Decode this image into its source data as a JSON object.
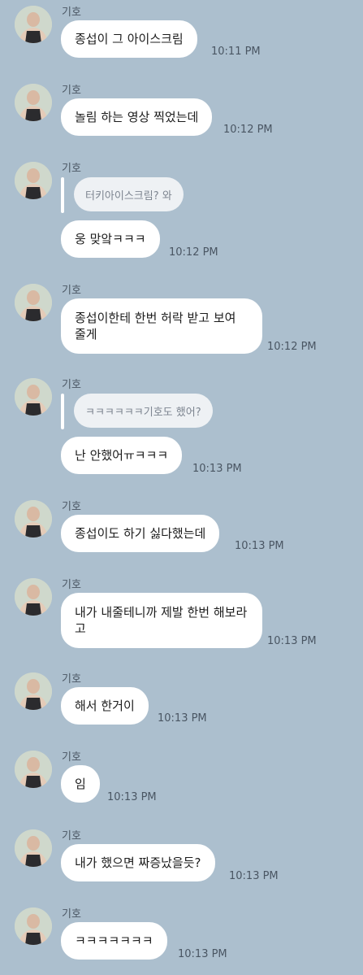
{
  "colors": {
    "background": "#acbfce",
    "bubble": "#ffffff",
    "quote_bubble": "#eef1f4"
  },
  "messages": [
    {
      "sender": "기호",
      "text": "종섭이 그 아이스크림",
      "time": "10:11 PM"
    },
    {
      "sender": "기호",
      "text": "놀림 하는 영상 찍었는데",
      "time": "10:12 PM"
    },
    {
      "sender": "기호",
      "quote": "터키아이스크림? 와",
      "text": "웅 맞앜ㅋㅋㅋ",
      "time": "10:12 PM"
    },
    {
      "sender": "기호",
      "text": "종섭이한테 한번 허락 받고 보여 줄게",
      "time": "10:12 PM"
    },
    {
      "sender": "기호",
      "quote": "ㅋㅋㅋㅋㅋㅋ기호도 했어?",
      "text": "난 안했어ㅠㅋㅋㅋ",
      "time": "10:13 PM"
    },
    {
      "sender": "기호",
      "text": "종섭이도 하기 싫다했는데",
      "time": "10:13 PM"
    },
    {
      "sender": "기호",
      "text": "내가 내줄테니까 제발 한번 해보라고",
      "time": "10:13 PM"
    },
    {
      "sender": "기호",
      "text": "해서 한거이",
      "time": "10:13 PM"
    },
    {
      "sender": "기호",
      "text": "임",
      "time": "10:13 PM"
    },
    {
      "sender": "기호",
      "text": "내가 했으면 짜증났을듯?",
      "time": "10:13 PM"
    },
    {
      "sender": "기호",
      "text": "ㅋㅋㅋㅋㅋㅋㅋ",
      "time": "10:13 PM"
    }
  ]
}
